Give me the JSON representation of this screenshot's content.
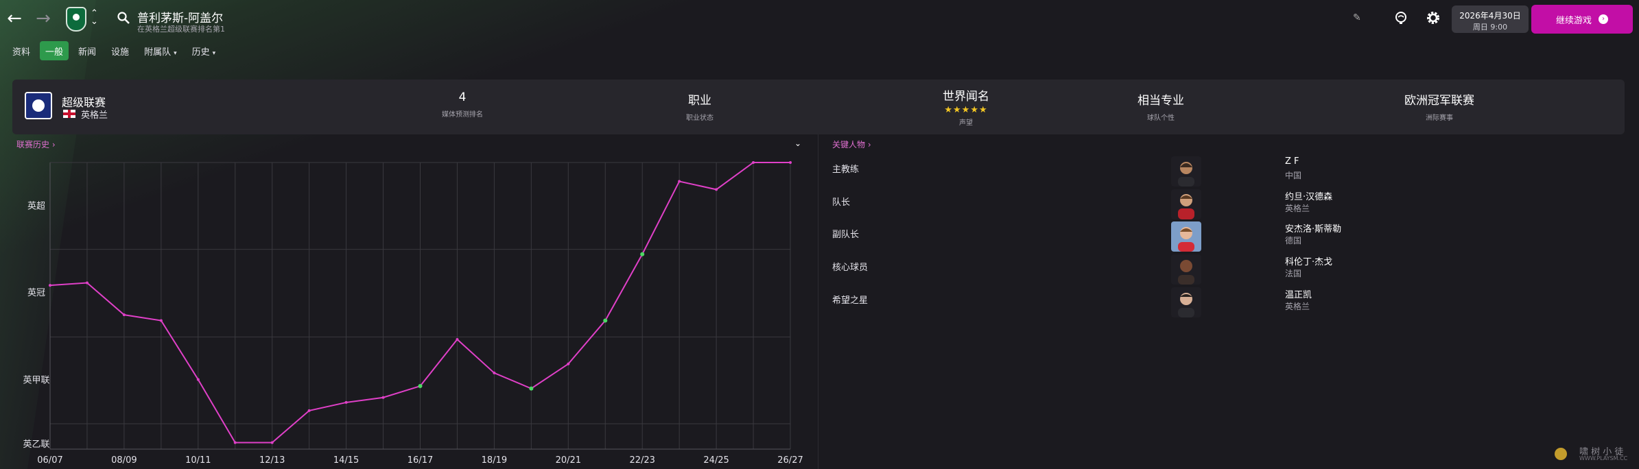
{
  "header": {
    "club_name": "普利茅斯-阿盖尔",
    "club_subtitle": "在英格兰超级联赛排名第1",
    "date_line1": "2026年4月30日",
    "date_line2": "周日 9:00",
    "continue_label": "继续游戏"
  },
  "tabs": [
    {
      "label": "资料"
    },
    {
      "label": "一般",
      "active": true
    },
    {
      "label": "新闻"
    },
    {
      "label": "设施"
    },
    {
      "label": "附属队",
      "dropdown": true
    },
    {
      "label": "历史",
      "dropdown": true
    }
  ],
  "summary": {
    "competition": "超级联赛",
    "country": "英格兰",
    "stats": [
      {
        "value": "4",
        "label": "媒体预测排名"
      },
      {
        "value": "职业",
        "label": "职业状态"
      },
      {
        "value": "世界闻名",
        "label": "声望",
        "stars": "★★★★★"
      },
      {
        "value": "相当专业",
        "label": "球队个性"
      },
      {
        "value": "欧洲冠军联赛",
        "label": "洲际赛事"
      }
    ]
  },
  "history": {
    "header": "联赛历史",
    "collapse_icon": "chevron-down-icon"
  },
  "chart_data": {
    "type": "line",
    "title": "",
    "xlabel": "",
    "ylabel": "",
    "x": [
      "06/07",
      "07/08",
      "08/09",
      "09/10",
      "10/11",
      "11/12",
      "12/13",
      "13/14",
      "14/15",
      "15/16",
      "16/17",
      "17/18",
      "18/19",
      "19/20",
      "20/21",
      "21/22",
      "22/23",
      "23/24",
      "24/25",
      "25/26",
      "26/27"
    ],
    "x_tick_labels": [
      "06/07",
      "08/09",
      "10/11",
      "12/13",
      "14/15",
      "16/17",
      "18/19",
      "20/21",
      "22/23",
      "24/25",
      "26/27"
    ],
    "y_tick_labels": [
      "英超",
      "英冠",
      "英甲联",
      "英乙联"
    ],
    "series": [
      {
        "color": "#e040c8",
        "values": [
          26,
          25.7,
          29.6,
          30.3,
          37.5,
          45.2,
          45.2,
          41.3,
          40.3,
          39.7,
          38.3,
          32.6,
          36.7,
          38.6,
          35.6,
          30.3,
          22.2,
          13.3,
          14.3,
          11,
          11
        ]
      }
    ],
    "promotion_markers": [
      10,
      13,
      15,
      16
    ],
    "grid": true
  },
  "key_people": {
    "header": "关键人物",
    "rows": [
      {
        "role": "主教练",
        "name": "Z F",
        "nation": "中国"
      },
      {
        "role": "队长",
        "name": "约旦·汉德森",
        "nation": "英格兰"
      },
      {
        "role": "副队长",
        "name": "安杰洛·斯蒂勒",
        "nation": "德国"
      },
      {
        "role": "核心球员",
        "name": "科伦丁·杰戈",
        "nation": "法国"
      },
      {
        "role": "希望之星",
        "name": "温正凯",
        "nation": "英格兰"
      }
    ]
  },
  "watermark": {
    "text": "啸 树 小 徒",
    "sub": "WWW.PLAYSM.CC"
  }
}
